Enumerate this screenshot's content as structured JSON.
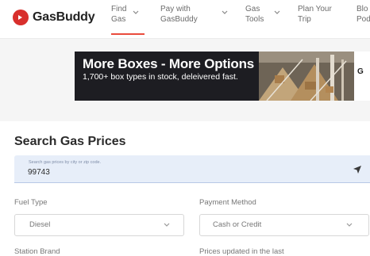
{
  "header": {
    "logo_text": "GasBuddy",
    "nav": [
      {
        "label": "Find\nGas",
        "active": true
      },
      {
        "label": "Pay with\nGasBuddy"
      },
      {
        "label": "Gas\nTools"
      },
      {
        "label": "Plan Your\nTrip"
      },
      {
        "label": "Blo\nPod"
      }
    ]
  },
  "ad": {
    "title": "More Boxes - More Options",
    "subtitle": "1,700+ box types in stock, deleivered fast.",
    "side_text": "G"
  },
  "search": {
    "title": "Search Gas Prices",
    "input_label": "Search gas prices by city or zip code.",
    "input_value": "99743"
  },
  "filters": {
    "fuel_type_label": "Fuel Type",
    "fuel_type_value": "Diesel",
    "payment_label": "Payment Method",
    "payment_value": "Cash or Credit",
    "station_brand_label": "Station Brand",
    "prices_updated_label": "Prices updated in the last"
  },
  "colors": {
    "brand_red": "#d82f2c",
    "active_underline": "#e94b3c",
    "search_bg": "#e7eef9"
  },
  "icons": {
    "logo": "gasbuddy-logo-icon",
    "nav_chevron": "chevron-down-icon",
    "locate": "location-arrow-icon",
    "select_chevron": "chevron-down-icon"
  }
}
